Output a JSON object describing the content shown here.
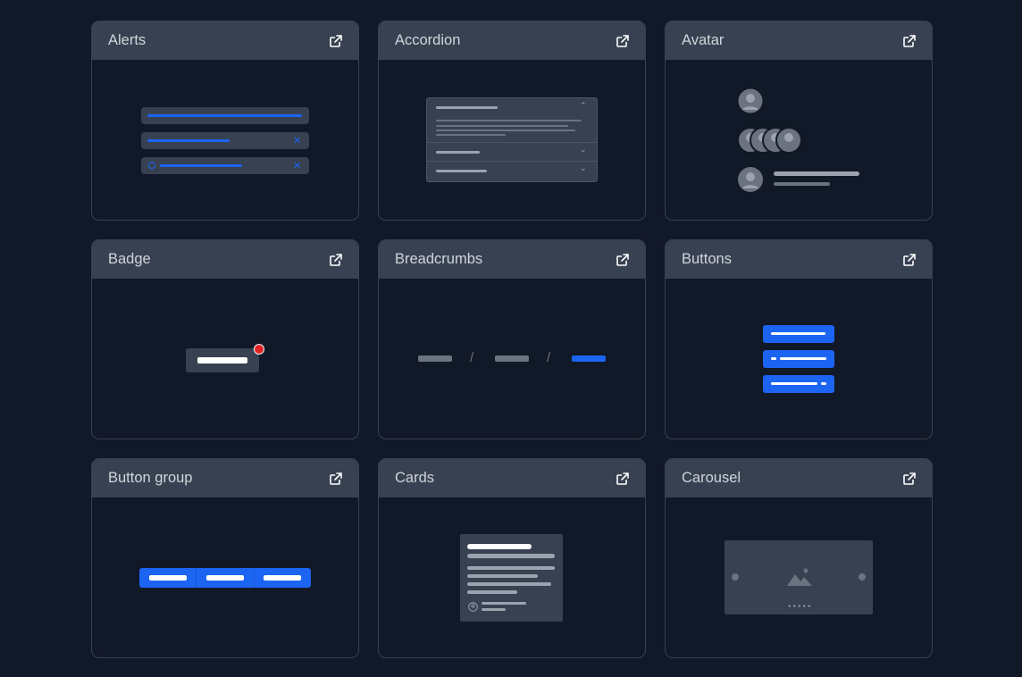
{
  "components": [
    {
      "id": "alerts",
      "title": "Alerts",
      "icon": "external-link-icon"
    },
    {
      "id": "accordion",
      "title": "Accordion",
      "icon": "external-link-icon"
    },
    {
      "id": "avatar",
      "title": "Avatar",
      "icon": "external-link-icon"
    },
    {
      "id": "badge",
      "title": "Badge",
      "icon": "external-link-icon"
    },
    {
      "id": "breadcrumbs",
      "title": "Breadcrumbs",
      "icon": "external-link-icon"
    },
    {
      "id": "buttons",
      "title": "Buttons",
      "icon": "external-link-icon"
    },
    {
      "id": "button-group",
      "title": "Button group",
      "icon": "external-link-icon"
    },
    {
      "id": "cards",
      "title": "Cards",
      "icon": "external-link-icon"
    },
    {
      "id": "carousel",
      "title": "Carousel",
      "icon": "external-link-icon"
    }
  ],
  "breadcrumbs": {
    "separator": "/"
  },
  "colors": {
    "background": "#111827",
    "header": "#374151",
    "accent": "#1c64f2",
    "badge_dot": "#e02424",
    "muted": "#6b7280"
  }
}
